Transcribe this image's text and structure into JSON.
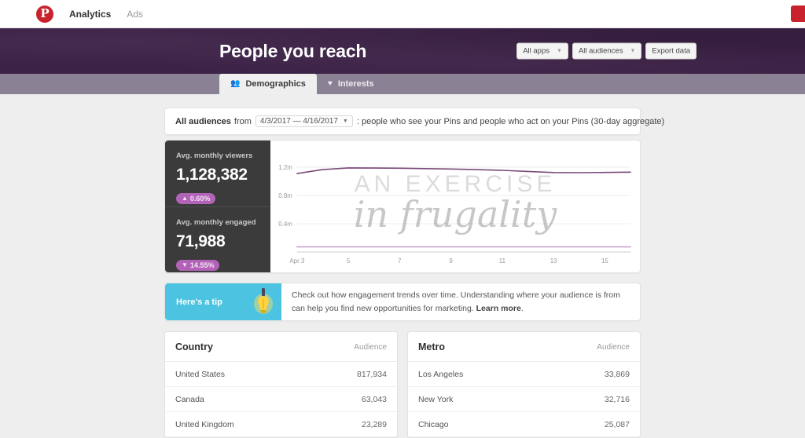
{
  "topnav": {
    "logo_letter": "P",
    "logo_icon": "pinterest-logo",
    "links": [
      {
        "label": "Analytics",
        "active": true
      },
      {
        "label": "Ads",
        "active": false
      }
    ]
  },
  "header": {
    "title": "People you reach",
    "buttons": [
      {
        "label": "All apps",
        "caret": "▼"
      },
      {
        "label": "All audiences",
        "caret": "▼"
      },
      {
        "label": "Export data",
        "caret": ""
      }
    ]
  },
  "tabs": [
    {
      "label": "Demographics",
      "icon": "👥",
      "active": true
    },
    {
      "label": "Interests",
      "icon": "♥",
      "active": false
    }
  ],
  "audience_bar": {
    "audience_label": "All audiences",
    "from_label": "from",
    "date_range": "4/3/2017 — 4/16/2017",
    "caret": "▼",
    "description": ": people who see your Pins and people who act on your Pins (30-day aggregate)"
  },
  "metrics": [
    {
      "label": "Avg. monthly viewers",
      "value": "1,128,382",
      "change": "0.60%",
      "direction": "up",
      "arrow": "▲"
    },
    {
      "label": "Avg. monthly engaged",
      "value": "71,988",
      "change": "14.55%",
      "direction": "down",
      "arrow": "▼"
    }
  ],
  "watermark": {
    "line1": "AN EXERCISE",
    "line2": "in frugality"
  },
  "chart_data": {
    "type": "line",
    "title": "",
    "xlabel": "",
    "ylabel": "",
    "x": [
      "Apr 3",
      "4",
      "5",
      "6",
      "7",
      "8",
      "9",
      "10",
      "11",
      "12",
      "13",
      "14",
      "15",
      "16"
    ],
    "xtick_labels": [
      "Apr 3",
      "5",
      "7",
      "9",
      "11",
      "13",
      "15"
    ],
    "ytick_labels": [
      "0.4m",
      "0.8m",
      "1.2m"
    ],
    "ytick_values": [
      400000,
      800000,
      1200000
    ],
    "ylim": [
      0,
      1400000
    ],
    "grid": true,
    "legend": "none",
    "series": [
      {
        "name": "Avg. monthly viewers",
        "color": "#7a4a78",
        "values": [
          1110000,
          1165000,
          1190000,
          1188000,
          1185000,
          1180000,
          1174000,
          1166000,
          1156000,
          1140000,
          1124000,
          1122000,
          1126000,
          1130000
        ]
      },
      {
        "name": "Avg. monthly engaged",
        "color": "#c49cc4",
        "values": [
          72500,
          72400,
          72300,
          72200,
          72100,
          72000,
          72000,
          71900,
          71900,
          71900,
          71800,
          71800,
          71900,
          72000
        ]
      }
    ]
  },
  "tip": {
    "label": "Here's a tip",
    "icon": "lightbulb",
    "body": "Check out how engagement trends over time. Understanding where your audience is from can help you find new opportunities for marketing.",
    "link": "Learn more",
    "period": "."
  },
  "tables": [
    {
      "title": "Country",
      "audience_header": "Audience",
      "rows": [
        {
          "name": "United States",
          "value": "817,934"
        },
        {
          "name": "Canada",
          "value": "63,043"
        },
        {
          "name": "United Kingdom",
          "value": "23,289"
        }
      ]
    },
    {
      "title": "Metro",
      "audience_header": "Audience",
      "rows": [
        {
          "name": "Los Angeles",
          "value": "33,869"
        },
        {
          "name": "New York",
          "value": "32,716"
        },
        {
          "name": "Chicago",
          "value": "25,087"
        }
      ]
    }
  ],
  "colors": {
    "brand_red": "#c8232c",
    "hero_purple": "#3d2247",
    "tab_strip": "#8b8195",
    "metrics_dark": "#3b3b3b",
    "badge_purple": "#b263b7",
    "tip_blue": "#4cc3e0",
    "line_primary": "#7a4a78",
    "line_secondary": "#c49cc4"
  }
}
